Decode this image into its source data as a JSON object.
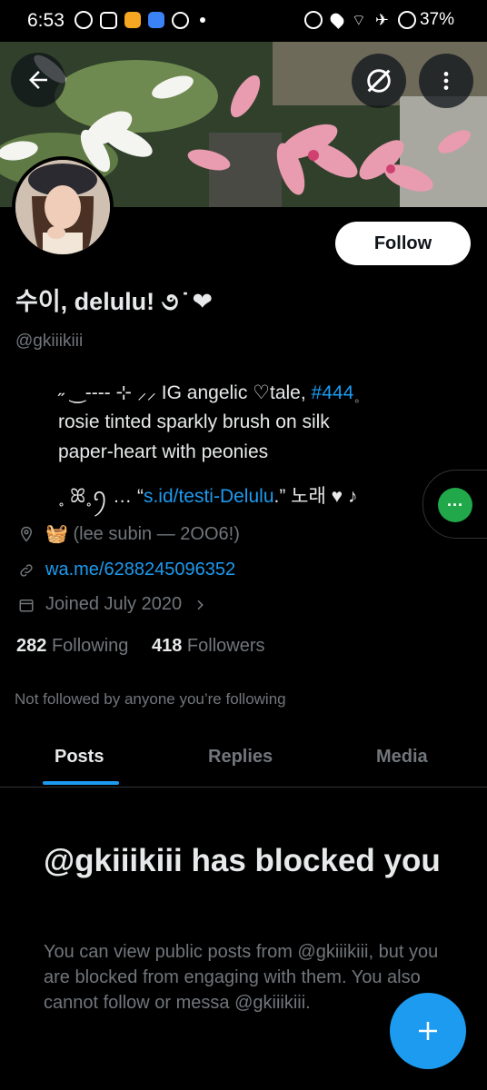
{
  "status_bar": {
    "time": "6:53",
    "battery": "37%"
  },
  "profile": {
    "display_name": "수이, delulu! ૭ ̇ ❤",
    "handle": "@gkiiikiii",
    "follow_label": "Follow",
    "bio": {
      "line1_prefix": "˶ ‿---- ⊹ ⸝⸝ IG  angelic  ♡tale, ",
      "line1_tag": "#444",
      "line1_suffix": "˳",
      "line2": "rosie  tinted  sparkly  brush  on  silk",
      "line3": "paper-heart with  peonies",
      "line4_prefix": "˳  ꕤ˳ꪆ  …  “",
      "line4_link": "s.id/testi-Delulu",
      "line4_suffix": ".”  노래  ♥ ♪"
    },
    "location": "🧺  (lee subin — 2OO6!)",
    "website": "wa.me/6288245096352",
    "joined": "Joined July 2020",
    "following_count": "282",
    "following_label": "Following",
    "followers_count": "418",
    "followers_label": "Followers",
    "not_followed": "Not followed by anyone you’re following"
  },
  "tabs": [
    {
      "label": "Posts",
      "active": true
    },
    {
      "label": "Replies",
      "active": false
    },
    {
      "label": "Media",
      "active": false
    }
  ],
  "blocked": {
    "title": "@gkiiikiii has blocked you",
    "text": "You can view public posts from @gkiiikiii, but you are blocked from engaging with them. You also cannot follow or messa @gkiiikiii."
  },
  "bubble_label": "···",
  "colors": {
    "accent": "#1d9bf0",
    "background": "#000000",
    "muted": "#71767b",
    "bubble": "#21a84a"
  },
  "icons": [
    "back-arrow-icon",
    "grok-icon",
    "more-icon",
    "location-icon",
    "link-icon",
    "calendar-icon",
    "chevron-right-icon",
    "compose-plus-icon"
  ]
}
